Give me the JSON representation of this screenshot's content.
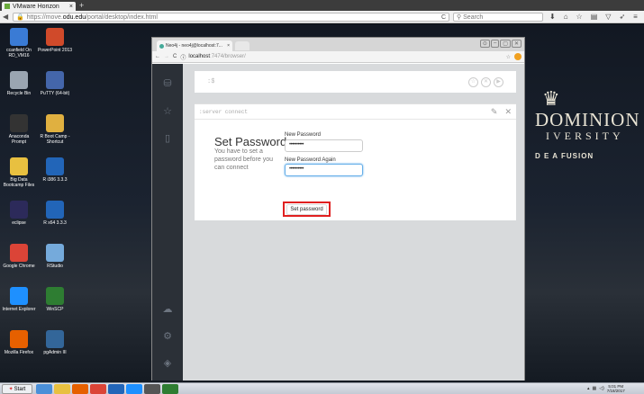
{
  "host_browser": {
    "tab_title": "VMware Horizon",
    "new_tab": "+",
    "close": "×",
    "url_prefix": "https://move.",
    "url_domain": "odu.edu",
    "url_path": "/portal/desktop/index.html",
    "reload": "C",
    "search_placeholder": "Search"
  },
  "desktop": {
    "icons": [
      {
        "label": "ccanfield On RD_VM16",
        "color": "#3a7bd5"
      },
      {
        "label": "PowerPoint 2013",
        "color": "#d04a2a"
      },
      {
        "label": "Recycle Bin",
        "color": "#9aa5b1"
      },
      {
        "label": "PuTTY (64-bit)",
        "color": "#4466aa"
      },
      {
        "label": "Anaconda Prompt",
        "color": "#333333"
      },
      {
        "label": "R Boot Camp - Shortcut",
        "color": "#e0b040"
      },
      {
        "label": "Big Data Bootcamp Files",
        "color": "#e8c040"
      },
      {
        "label": "R i386 3.3.3",
        "color": "#2265b8"
      },
      {
        "label": "eclipse",
        "color": "#2c2a5a"
      },
      {
        "label": "R x64 3.3.3",
        "color": "#2265b8"
      },
      {
        "label": "Google Chrome",
        "color": "#db4437"
      },
      {
        "label": "RStudio",
        "color": "#75aadb"
      },
      {
        "label": "Internet Explorer",
        "color": "#1e90ff"
      },
      {
        "label": "WinSCP",
        "color": "#2e7d32"
      },
      {
        "label": "Mozilla Firefox",
        "color": "#e66000"
      },
      {
        "label": "pgAdmin III",
        "color": "#336699"
      }
    ],
    "brand": {
      "line1": "DOMINION",
      "line2": "IVERSITY",
      "line3": "D E A FUSION"
    }
  },
  "inner_browser": {
    "tab_title": "Neo4j - neo4j@localhost:7...",
    "close": "×",
    "url_host": "localhost",
    "url_path": ":7474/browser/"
  },
  "neo4j": {
    "editor_prompt": ":$",
    "frame_command": ":server connect",
    "title": "Set Password",
    "description": "You have to set a password before you can connect",
    "new_password_label": "New Password",
    "new_password_value": "••••••••••",
    "new_password_again_label": "New Password Again",
    "new_password_again_value": "••••••••••",
    "submit_label": "Set password"
  },
  "taskbar": {
    "start_label": "Start",
    "clock_time": "5:01 PM",
    "clock_date": "7/18/2017",
    "app_colors": [
      "#4a8fd8",
      "#e8c040",
      "#e66000",
      "#db4437",
      "#2265b8",
      "#1e90ff",
      "#555555",
      "#2e7d32"
    ]
  },
  "colors": {
    "highlight": "#e02020",
    "sidebar": "#2b3037",
    "focus": "#66afe9"
  }
}
